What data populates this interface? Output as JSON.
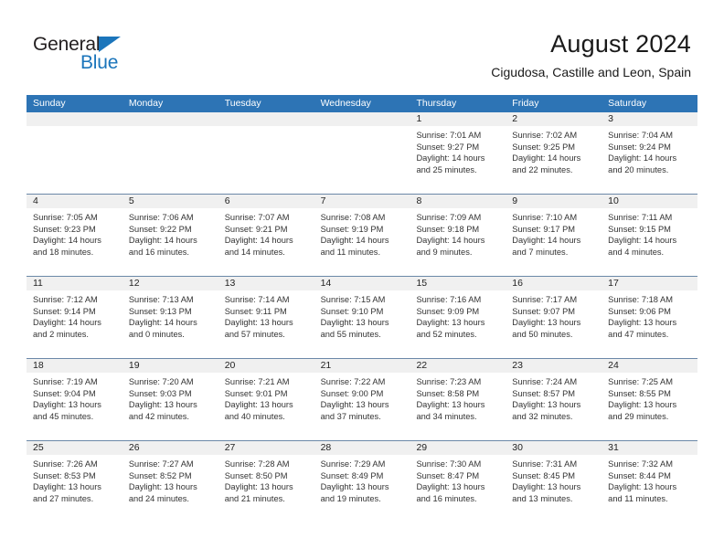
{
  "brand": {
    "name_top": "General",
    "name_bottom": "Blue",
    "triangle_color": "#1b75bb"
  },
  "header": {
    "title": "August 2024",
    "subtitle": "Cigudosa, Castille and Leon, Spain"
  },
  "theme": {
    "header_blue": "#2d74b5",
    "day_band_gray": "#f0f0f0",
    "row_divider": "#6b88a8"
  },
  "calendar": {
    "weekdays": [
      "Sunday",
      "Monday",
      "Tuesday",
      "Wednesday",
      "Thursday",
      "Friday",
      "Saturday"
    ],
    "weeks": [
      [
        {
          "day": "",
          "empty": true,
          "lines": []
        },
        {
          "day": "",
          "empty": true,
          "lines": []
        },
        {
          "day": "",
          "empty": true,
          "lines": []
        },
        {
          "day": "",
          "empty": true,
          "lines": []
        },
        {
          "day": "1",
          "empty": false,
          "lines": [
            "Sunrise: 7:01 AM",
            "Sunset: 9:27 PM",
            "Daylight: 14 hours",
            "and 25 minutes."
          ]
        },
        {
          "day": "2",
          "empty": false,
          "lines": [
            "Sunrise: 7:02 AM",
            "Sunset: 9:25 PM",
            "Daylight: 14 hours",
            "and 22 minutes."
          ]
        },
        {
          "day": "3",
          "empty": false,
          "lines": [
            "Sunrise: 7:04 AM",
            "Sunset: 9:24 PM",
            "Daylight: 14 hours",
            "and 20 minutes."
          ]
        }
      ],
      [
        {
          "day": "4",
          "empty": false,
          "lines": [
            "Sunrise: 7:05 AM",
            "Sunset: 9:23 PM",
            "Daylight: 14 hours",
            "and 18 minutes."
          ]
        },
        {
          "day": "5",
          "empty": false,
          "lines": [
            "Sunrise: 7:06 AM",
            "Sunset: 9:22 PM",
            "Daylight: 14 hours",
            "and 16 minutes."
          ]
        },
        {
          "day": "6",
          "empty": false,
          "lines": [
            "Sunrise: 7:07 AM",
            "Sunset: 9:21 PM",
            "Daylight: 14 hours",
            "and 14 minutes."
          ]
        },
        {
          "day": "7",
          "empty": false,
          "lines": [
            "Sunrise: 7:08 AM",
            "Sunset: 9:19 PM",
            "Daylight: 14 hours",
            "and 11 minutes."
          ]
        },
        {
          "day": "8",
          "empty": false,
          "lines": [
            "Sunrise: 7:09 AM",
            "Sunset: 9:18 PM",
            "Daylight: 14 hours",
            "and 9 minutes."
          ]
        },
        {
          "day": "9",
          "empty": false,
          "lines": [
            "Sunrise: 7:10 AM",
            "Sunset: 9:17 PM",
            "Daylight: 14 hours",
            "and 7 minutes."
          ]
        },
        {
          "day": "10",
          "empty": false,
          "lines": [
            "Sunrise: 7:11 AM",
            "Sunset: 9:15 PM",
            "Daylight: 14 hours",
            "and 4 minutes."
          ]
        }
      ],
      [
        {
          "day": "11",
          "empty": false,
          "lines": [
            "Sunrise: 7:12 AM",
            "Sunset: 9:14 PM",
            "Daylight: 14 hours",
            "and 2 minutes."
          ]
        },
        {
          "day": "12",
          "empty": false,
          "lines": [
            "Sunrise: 7:13 AM",
            "Sunset: 9:13 PM",
            "Daylight: 14 hours",
            "and 0 minutes."
          ]
        },
        {
          "day": "13",
          "empty": false,
          "lines": [
            "Sunrise: 7:14 AM",
            "Sunset: 9:11 PM",
            "Daylight: 13 hours",
            "and 57 minutes."
          ]
        },
        {
          "day": "14",
          "empty": false,
          "lines": [
            "Sunrise: 7:15 AM",
            "Sunset: 9:10 PM",
            "Daylight: 13 hours",
            "and 55 minutes."
          ]
        },
        {
          "day": "15",
          "empty": false,
          "lines": [
            "Sunrise: 7:16 AM",
            "Sunset: 9:09 PM",
            "Daylight: 13 hours",
            "and 52 minutes."
          ]
        },
        {
          "day": "16",
          "empty": false,
          "lines": [
            "Sunrise: 7:17 AM",
            "Sunset: 9:07 PM",
            "Daylight: 13 hours",
            "and 50 minutes."
          ]
        },
        {
          "day": "17",
          "empty": false,
          "lines": [
            "Sunrise: 7:18 AM",
            "Sunset: 9:06 PM",
            "Daylight: 13 hours",
            "and 47 minutes."
          ]
        }
      ],
      [
        {
          "day": "18",
          "empty": false,
          "lines": [
            "Sunrise: 7:19 AM",
            "Sunset: 9:04 PM",
            "Daylight: 13 hours",
            "and 45 minutes."
          ]
        },
        {
          "day": "19",
          "empty": false,
          "lines": [
            "Sunrise: 7:20 AM",
            "Sunset: 9:03 PM",
            "Daylight: 13 hours",
            "and 42 minutes."
          ]
        },
        {
          "day": "20",
          "empty": false,
          "lines": [
            "Sunrise: 7:21 AM",
            "Sunset: 9:01 PM",
            "Daylight: 13 hours",
            "and 40 minutes."
          ]
        },
        {
          "day": "21",
          "empty": false,
          "lines": [
            "Sunrise: 7:22 AM",
            "Sunset: 9:00 PM",
            "Daylight: 13 hours",
            "and 37 minutes."
          ]
        },
        {
          "day": "22",
          "empty": false,
          "lines": [
            "Sunrise: 7:23 AM",
            "Sunset: 8:58 PM",
            "Daylight: 13 hours",
            "and 34 minutes."
          ]
        },
        {
          "day": "23",
          "empty": false,
          "lines": [
            "Sunrise: 7:24 AM",
            "Sunset: 8:57 PM",
            "Daylight: 13 hours",
            "and 32 minutes."
          ]
        },
        {
          "day": "24",
          "empty": false,
          "lines": [
            "Sunrise: 7:25 AM",
            "Sunset: 8:55 PM",
            "Daylight: 13 hours",
            "and 29 minutes."
          ]
        }
      ],
      [
        {
          "day": "25",
          "empty": false,
          "lines": [
            "Sunrise: 7:26 AM",
            "Sunset: 8:53 PM",
            "Daylight: 13 hours",
            "and 27 minutes."
          ]
        },
        {
          "day": "26",
          "empty": false,
          "lines": [
            "Sunrise: 7:27 AM",
            "Sunset: 8:52 PM",
            "Daylight: 13 hours",
            "and 24 minutes."
          ]
        },
        {
          "day": "27",
          "empty": false,
          "lines": [
            "Sunrise: 7:28 AM",
            "Sunset: 8:50 PM",
            "Daylight: 13 hours",
            "and 21 minutes."
          ]
        },
        {
          "day": "28",
          "empty": false,
          "lines": [
            "Sunrise: 7:29 AM",
            "Sunset: 8:49 PM",
            "Daylight: 13 hours",
            "and 19 minutes."
          ]
        },
        {
          "day": "29",
          "empty": false,
          "lines": [
            "Sunrise: 7:30 AM",
            "Sunset: 8:47 PM",
            "Daylight: 13 hours",
            "and 16 minutes."
          ]
        },
        {
          "day": "30",
          "empty": false,
          "lines": [
            "Sunrise: 7:31 AM",
            "Sunset: 8:45 PM",
            "Daylight: 13 hours",
            "and 13 minutes."
          ]
        },
        {
          "day": "31",
          "empty": false,
          "lines": [
            "Sunrise: 7:32 AM",
            "Sunset: 8:44 PM",
            "Daylight: 13 hours",
            "and 11 minutes."
          ]
        }
      ]
    ]
  }
}
